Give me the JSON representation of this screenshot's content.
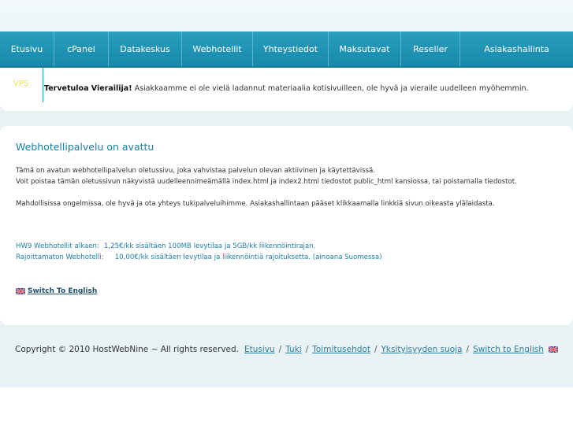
{
  "nav": {
    "items": [
      {
        "label": "Etusivu"
      },
      {
        "label": "cPanel"
      },
      {
        "label": "Datakeskus"
      },
      {
        "label": "Webhotellit"
      },
      {
        "label": "Yhteystiedot"
      },
      {
        "label": "Maksutavat"
      },
      {
        "label": "Reseller"
      },
      {
        "label": "Asiakashallinta"
      }
    ]
  },
  "welcome": {
    "tag": "VPS",
    "greeting": "Tervetuloa Vierailija!",
    "message": " Asiakkaamme ei ole vielä ladannut materiaalia kotisivuilleen, ole hyvä ja vieraile uudelleen myöhemmin."
  },
  "content": {
    "title": "Webhotellipalvelu on avattu",
    "para1_line1": "Tämä on avatun webhotellipalvelun oletussivu, joka vahvistaa palvelun olevan aktiivinen ja käytettävissä.",
    "para1_line2": "Voit poistaa tämän oletussivun näkyvistä uudelleennimeämällä index.html ja index2.html tiedostot public_html kansiossa, tai poistamalla tiedostot.",
    "para2": "Mahdollisissa ongelmissa, ole hyvä ja ota yhteys tukipalveluihimme. Asiakashallintaan pääset klikkaamalla linkkiä sivun oikeasta ylälaidasta.",
    "offer1_label": "HW9 Webhotellit alkaen:",
    "offer1_value": "1,25€/kk sisältäen 100MB levytilaa ja 5GB/kk liikennöintirajan.",
    "offer2_label": "Rajoittamaton Webhotelli:",
    "offer2_value": "10,00€/kk sisältäen levytilaa ja liikennöintiä rajoituksetta.  (ainoana Suomessa)",
    "switch_label": "Switch To English"
  },
  "footer": {
    "copyright": "Copyright © 2010 HostWebNine ~ All rights reserved.",
    "links": [
      {
        "label": "Etusivu"
      },
      {
        "label": "Tuki"
      },
      {
        "label": "Toimitusehdot"
      },
      {
        "label": "Yksityisyyden suoja"
      },
      {
        "label": "Switch to English"
      }
    ],
    "separator": "/"
  },
  "colors": {
    "nav_bg": "#1a8db0",
    "accent": "#1a7fa3",
    "page_bg": "#e9f3f6",
    "vps_tag": "#f0e24a"
  },
  "icons": {
    "flag": "uk-flag-icon"
  }
}
